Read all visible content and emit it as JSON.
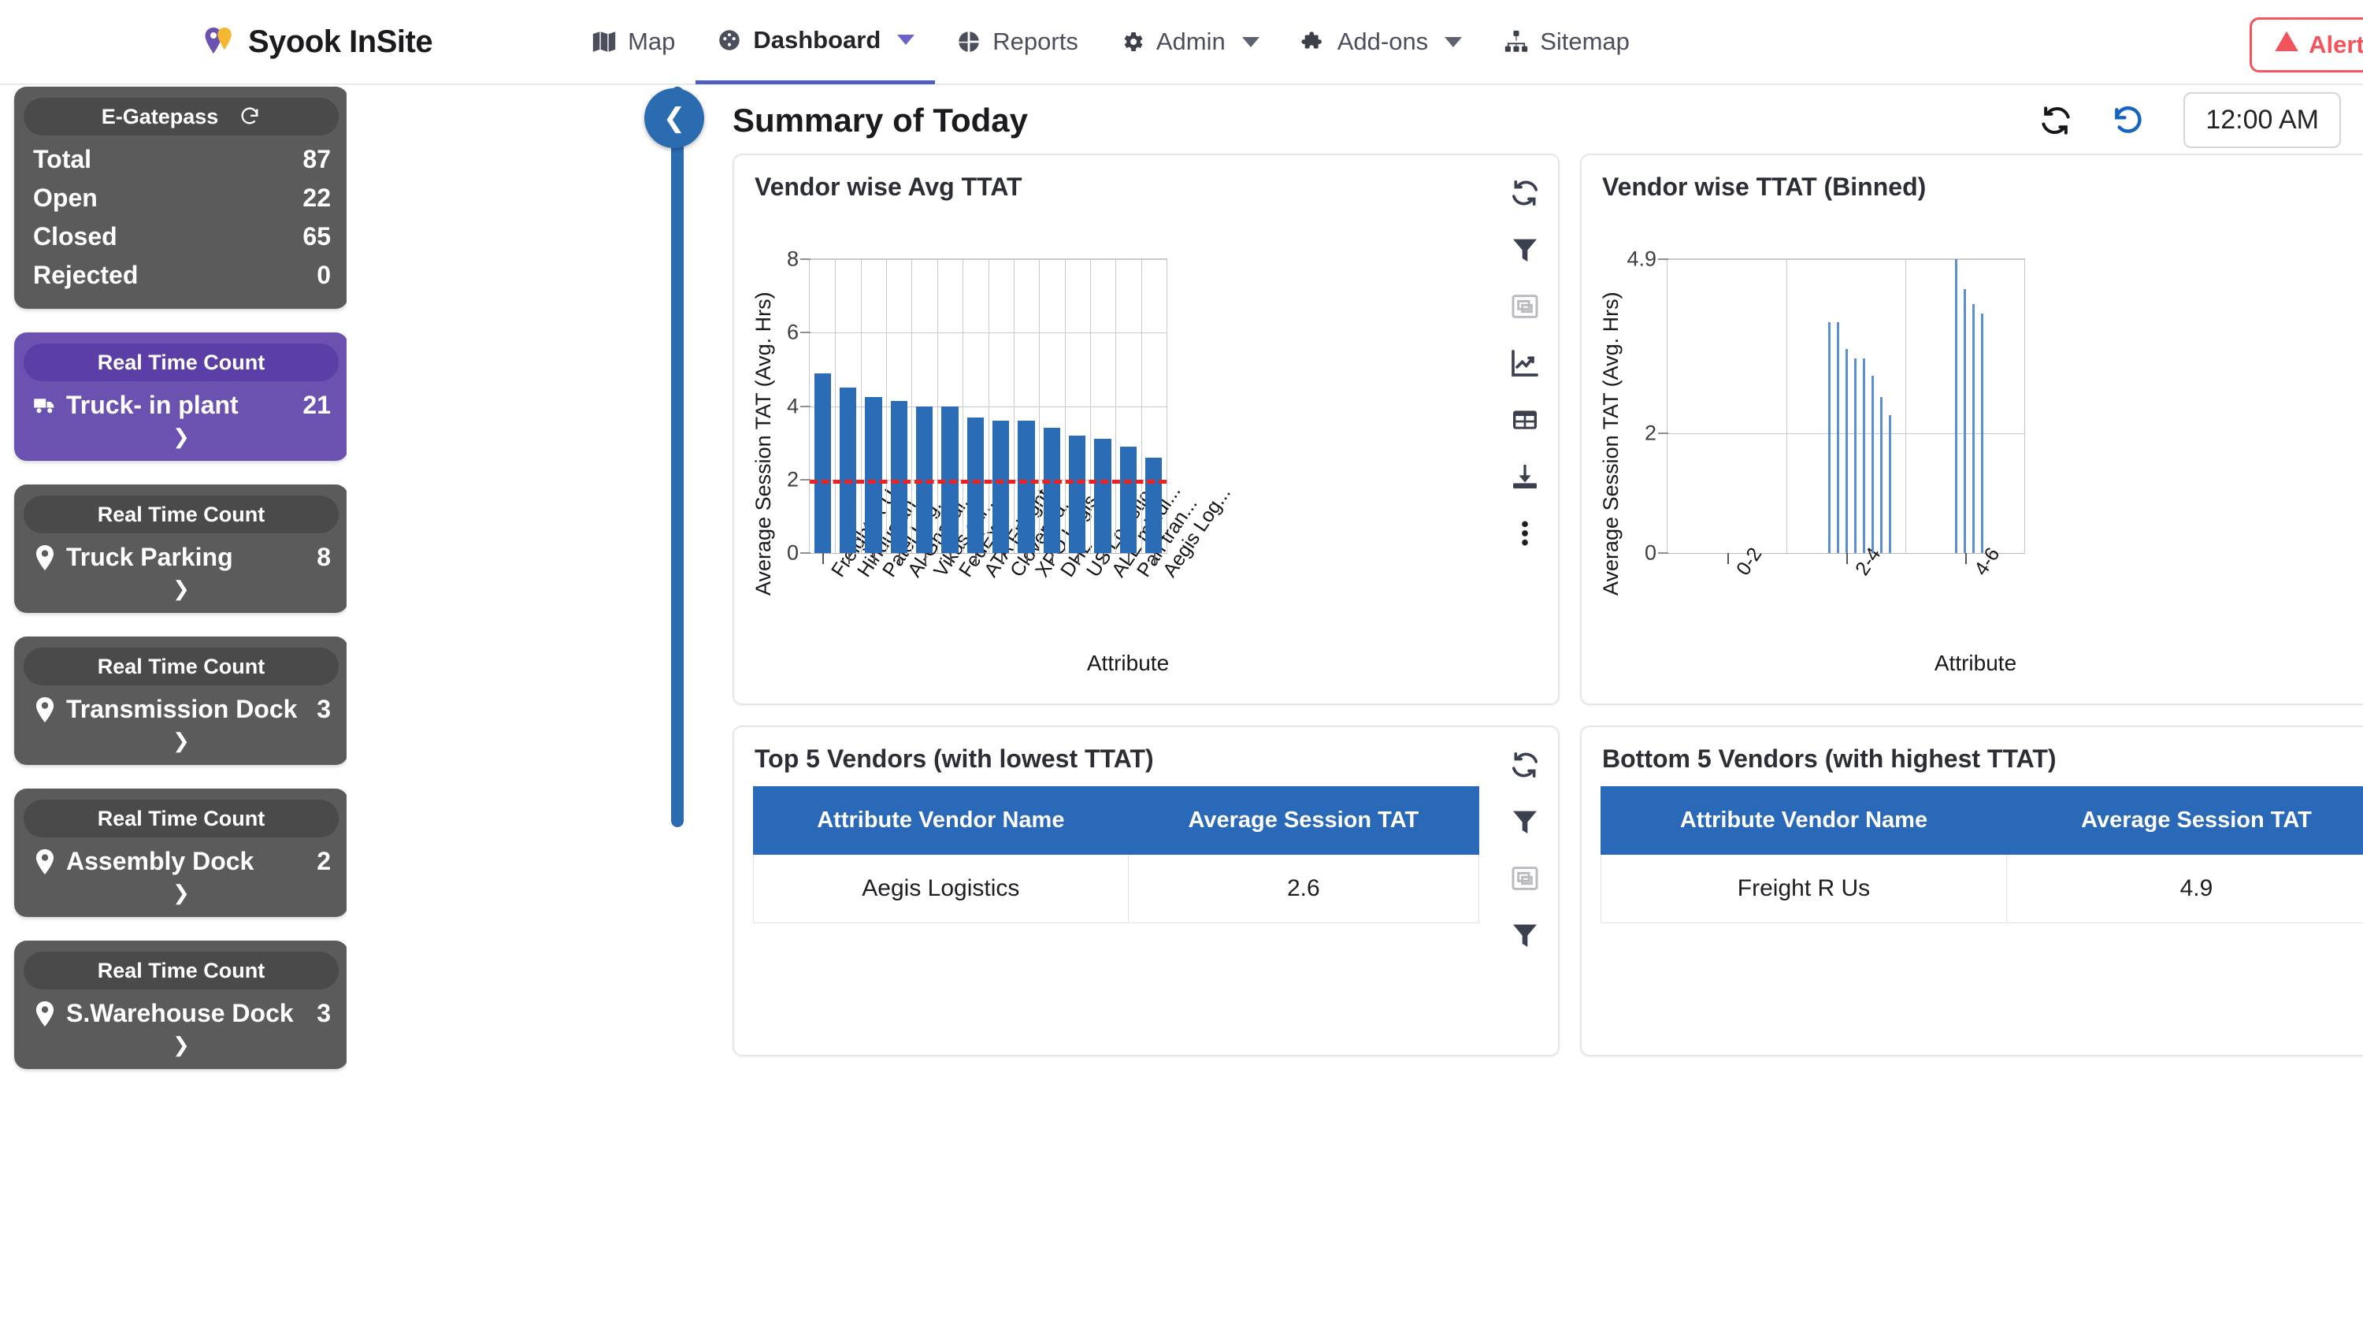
{
  "brand": {
    "name": "Syook InSite"
  },
  "nav": {
    "items": [
      {
        "label": "Map",
        "icon": "map-icon",
        "active": false,
        "dropdown": false
      },
      {
        "label": "Dashboard",
        "icon": "dashboard-icon",
        "active": true,
        "dropdown": true
      },
      {
        "label": "Reports",
        "icon": "reports-icon",
        "active": false,
        "dropdown": false
      },
      {
        "label": "Admin",
        "icon": "gear-icon",
        "active": false,
        "dropdown": true
      },
      {
        "label": "Add-ons",
        "icon": "puzzle-icon",
        "active": false,
        "dropdown": true
      },
      {
        "label": "Sitemap",
        "icon": "sitemap-icon",
        "active": false,
        "dropdown": false
      }
    ],
    "alert_label": "Alerts",
    "alert_color": "#f2545b"
  },
  "sidebar": {
    "cards": [
      {
        "title": "E-Gatepass",
        "has_refresh": true,
        "purple": false,
        "rows": [
          {
            "label": "Total",
            "value": "87",
            "icon": ""
          },
          {
            "label": "Open",
            "value": "22",
            "icon": ""
          },
          {
            "label": "Closed",
            "value": "65",
            "icon": ""
          },
          {
            "label": "Rejected",
            "value": "0",
            "icon": ""
          }
        ],
        "chevron": false
      },
      {
        "title": "Real Time Count",
        "has_refresh": false,
        "purple": true,
        "rows": [
          {
            "label": "Truck- in plant",
            "value": "21",
            "icon": "truck-icon"
          }
        ],
        "chevron": true
      },
      {
        "title": "Real Time Count",
        "has_refresh": false,
        "purple": false,
        "rows": [
          {
            "label": "Truck Parking",
            "value": "8",
            "icon": "location-pin-icon"
          }
        ],
        "chevron": true
      },
      {
        "title": "Real Time Count",
        "has_refresh": false,
        "purple": false,
        "rows": [
          {
            "label": "Transmission Dock",
            "value": "3",
            "icon": "location-pin-icon"
          }
        ],
        "chevron": true
      },
      {
        "title": "Real Time Count",
        "has_refresh": false,
        "purple": false,
        "rows": [
          {
            "label": "Assembly Dock",
            "value": "2",
            "icon": "location-pin-icon"
          }
        ],
        "chevron": true
      },
      {
        "title": "Real Time Count",
        "has_refresh": false,
        "purple": false,
        "rows": [
          {
            "label": "S.Warehouse Dock",
            "value": "3",
            "icon": "location-pin-icon"
          }
        ],
        "chevron": true
      }
    ]
  },
  "main": {
    "page_title": "Summary of Today",
    "time_value": "12:00 AM",
    "panels": {
      "avg_ttat_title": "Vendor wise Avg TTAT",
      "binned_title": "Vendor wise TTAT (Binned)",
      "top5_title": "Top 5 Vendors (with lowest TTAT)",
      "bottom5_title": "Bottom 5 Vendors (with highest TTAT)"
    },
    "tools": [
      "refresh-icon",
      "filter-icon",
      "focus-icon",
      "trend-icon",
      "table-icon",
      "download-icon",
      "more-icon"
    ]
  },
  "tables": {
    "top5": {
      "columns": [
        "Attribute Vendor Name",
        "Average Session TAT"
      ],
      "rows": [
        [
          "Aegis Logistics",
          "2.6"
        ]
      ]
    },
    "bottom5": {
      "columns": [
        "Attribute Vendor Name",
        "Average Session TAT"
      ],
      "rows": [
        [
          "Freight R Us",
          "4.9"
        ]
      ]
    }
  },
  "chart_data": [
    {
      "type": "bar",
      "title": "Vendor wise Avg TTAT",
      "xlabel": "Attribute",
      "ylabel": "Average Session TAT (Avg. Hrs)",
      "ylim": [
        0,
        8
      ],
      "yticks": [
        0,
        2,
        4,
        6,
        8
      ],
      "grid": true,
      "threshold": 2,
      "threshold_color": "#ef2020",
      "bar_color": "#2a6cb5",
      "categories": [
        "Freight R Us",
        "Hindustan...",
        "Patel Log...",
        "Al-Ghazal...",
        "Vikas car...",
        "FedEx",
        "ATA Frieght",
        "Clover ca...",
        "XPO Logis...",
        "DHL",
        "US Logistics",
        "ALE middl...",
        "Pari tran...",
        "Aegis Log..."
      ],
      "values": [
        4.9,
        4.5,
        4.25,
        4.15,
        4.0,
        4.0,
        3.7,
        3.6,
        3.6,
        3.4,
        3.2,
        3.1,
        2.9,
        2.6
      ]
    },
    {
      "type": "bar",
      "title": "Vendor wise TTAT (Binned)",
      "xlabel": "Attribute",
      "ylabel": "Average Session TAT (Avg. Hrs)",
      "ylim": [
        0,
        4.9
      ],
      "yticks": [
        0,
        2,
        4.9
      ],
      "grid": true,
      "bar_color": "#5b8fd4",
      "categories": [
        "0-2",
        "2-4",
        "4-6"
      ],
      "bin_values": [
        3.85,
        3.85,
        3.4,
        3.25,
        3.25,
        2.95,
        2.6,
        2.3,
        4.9,
        4.4,
        4.15,
        4.0
      ]
    }
  ]
}
